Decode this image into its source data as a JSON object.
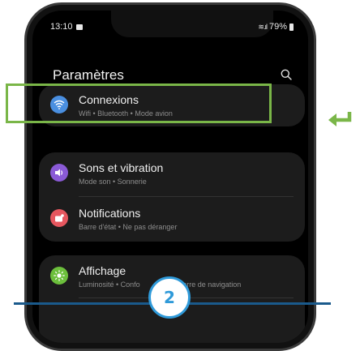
{
  "status_bar": {
    "time": "13:10",
    "battery": "79%"
  },
  "header": {
    "title": "Paramètres",
    "search_icon": "search-icon"
  },
  "settings": [
    {
      "label": "Connexions",
      "subtitle": "Wifi • Bluetooth • Mode avion",
      "icon": "wifi-icon",
      "icon_color": "#4a8fe0",
      "highlighted": true
    },
    {
      "label": "Sons et vibration",
      "subtitle": "Mode son • Sonnerie",
      "icon": "volume-icon",
      "icon_color": "#8a5ad6"
    },
    {
      "label": "Notifications",
      "subtitle": "Barre d'état • Ne pas déranger",
      "icon": "notification-icon",
      "icon_color": "#e6575f"
    },
    {
      "label": "Affichage",
      "subtitle": "Luminosité • Confo",
      "subtitle_right": "Barre de navigation",
      "icon": "brightness-icon",
      "icon_color": "#6cbf3c"
    }
  ],
  "annotation": {
    "step_number": "2",
    "highlight_color": "#7ab648",
    "accent_color": "#2f9ad9",
    "arrow_icon": "return-arrow-icon"
  }
}
